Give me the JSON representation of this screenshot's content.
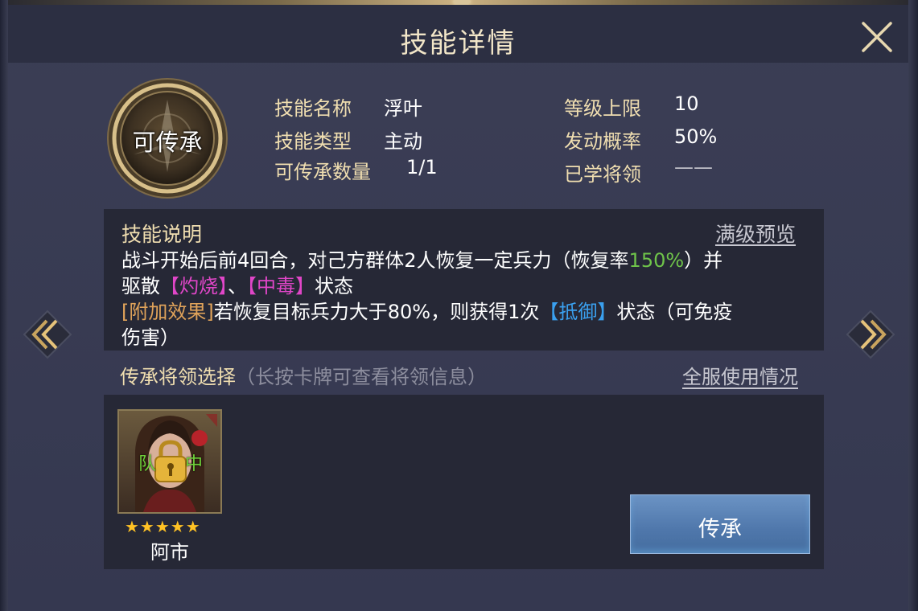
{
  "dialog": {
    "title": "技能详情",
    "close_icon": "close-icon"
  },
  "skill": {
    "badge_text": "可传承",
    "labels": {
      "name": "技能名称",
      "type": "技能类型",
      "inherit_count": "可传承数量",
      "level_cap": "等级上限",
      "trigger_rate": "发动概率",
      "learned_by": "已学将领"
    },
    "values": {
      "name": "浮叶",
      "type": "主动",
      "inherit_count": "1/1",
      "level_cap": "10",
      "trigger_rate": "50%",
      "learned_by": "——"
    }
  },
  "description": {
    "title": "技能说明",
    "preview_link": "满级预览",
    "line1_a": "战斗开始后前4回合，对己方群体2人恢复一定兵力（恢复率",
    "line1_rate": "150%",
    "line1_b": "）并",
    "line2_a": "驱散",
    "line2_burn": "【灼烧】",
    "line2_sep": "、",
    "line2_poison": "【中毒】",
    "line2_b": "状态",
    "line3_tag": "[附加效果]",
    "line3_a": "若恢复目标兵力大于80%，则获得1次",
    "line3_block": "【抵御】",
    "line3_b": "状态（可免疫",
    "line4": "伤害）"
  },
  "selection": {
    "title": "传承将领选择",
    "hint": "（长按卡牌可查看将领信息）",
    "usage_link": "全服使用情况",
    "general": {
      "name": "阿市",
      "stars": "★★★★★",
      "star_count": 5,
      "lock_text_left": "队",
      "lock_text_right": "中",
      "lock_icon": "padlock-icon"
    },
    "inherit_button": "传承"
  },
  "nav": {
    "prev_icon": "double-chevron-left-icon",
    "next_icon": "double-chevron-right-icon"
  },
  "colors": {
    "accent_gold": "#f0deb0",
    "rate_green": "#6fc44a",
    "status_magenta": "#e046c8",
    "effect_orange": "#e0a35a",
    "status_blue": "#3aa0ef",
    "star_yellow": "#ffc224",
    "button_blue": "#5a82b6"
  }
}
